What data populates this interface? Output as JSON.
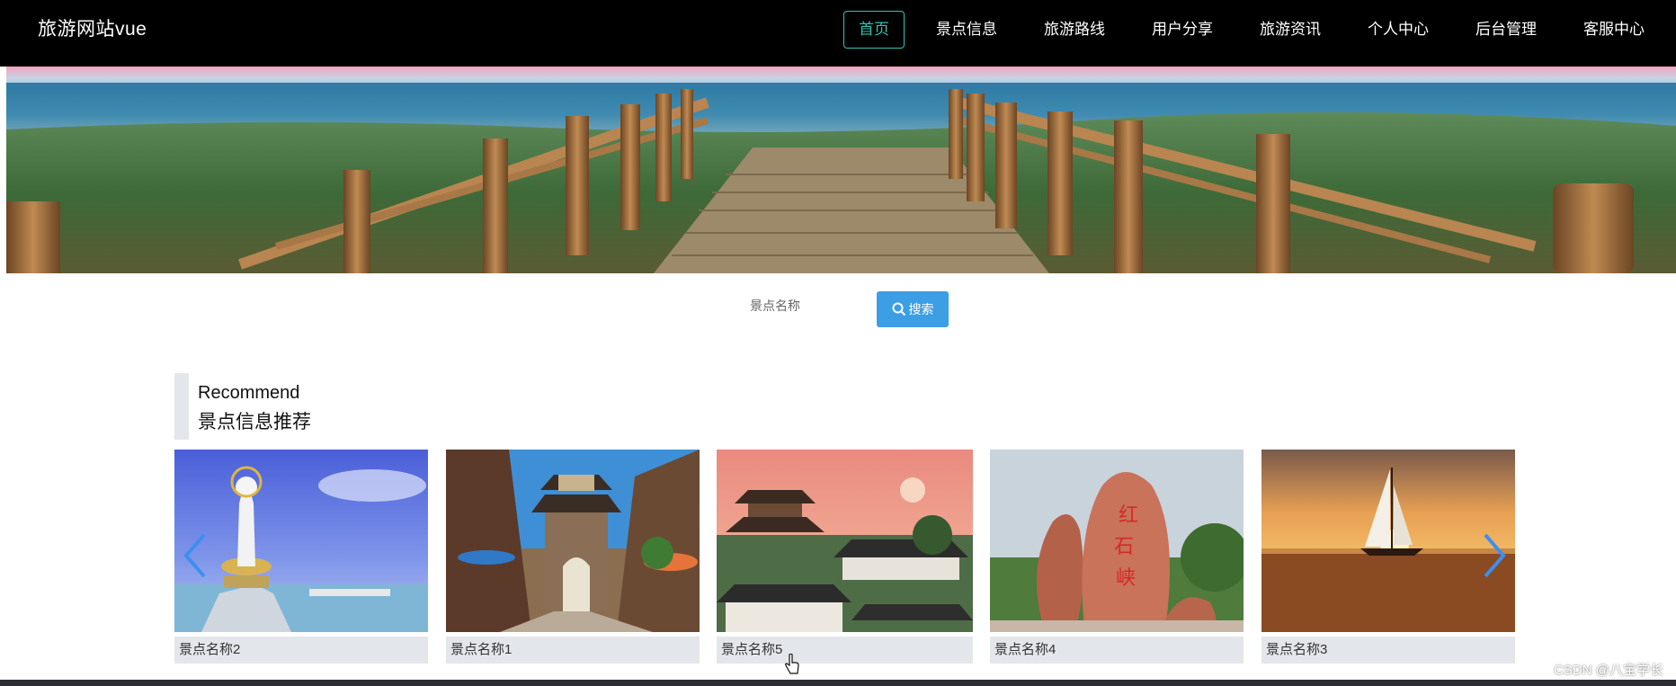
{
  "brand": {
    "title": "旅游网站vue"
  },
  "nav": {
    "items": [
      {
        "label": "首页",
        "active": true
      },
      {
        "label": "景点信息"
      },
      {
        "label": "旅游路线"
      },
      {
        "label": "用户分享"
      },
      {
        "label": "旅游资讯"
      },
      {
        "label": "个人中心"
      },
      {
        "label": "后台管理"
      },
      {
        "label": "客服中心"
      }
    ],
    "active_color": "#35c2b3"
  },
  "banner": {
    "slide_count": 3,
    "active_slide": 1
  },
  "search": {
    "label": "景点名称",
    "button_label": "搜索",
    "button_color": "#3c9ee5"
  },
  "section": {
    "title_en": "Recommend",
    "title_cn": "景点信息推荐"
  },
  "cards": [
    {
      "caption": "景点名称2",
      "image": "guanyin-statue"
    },
    {
      "caption": "景点名称1",
      "image": "old-town-gate"
    },
    {
      "caption": "景点名称5",
      "image": "temple-rooftops"
    },
    {
      "caption": "景点名称4",
      "image": "red-rock-carving"
    },
    {
      "caption": "景点名称3",
      "image": "sailboat-sunset"
    }
  ],
  "carousel": {
    "prev_icon": "chevron-left-icon",
    "next_icon": "chevron-right-icon",
    "arrow_color": "#3c8ff0"
  },
  "watermark": "CSDN @八宝学长"
}
